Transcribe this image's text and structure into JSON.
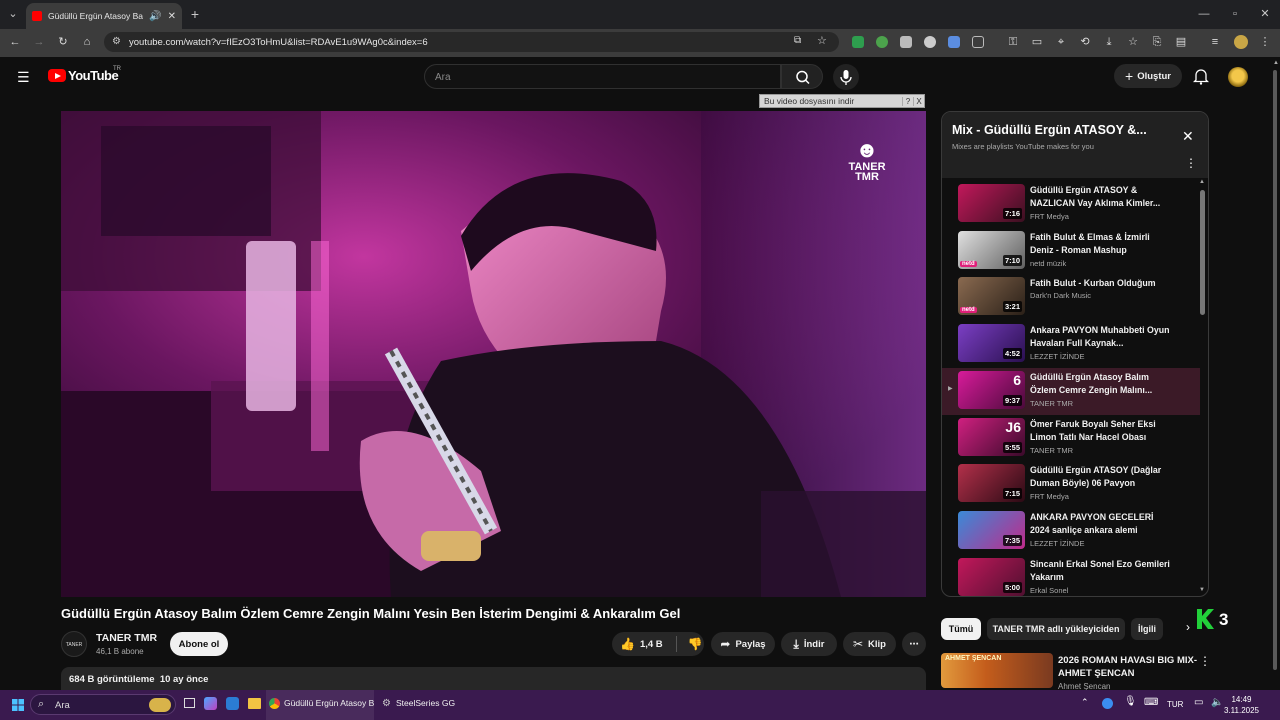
{
  "browser": {
    "tab_title": "Güdüllü Ergün Atasoy Balım",
    "url": "youtube.com/watch?v=fIEzO3ToHmU&list=RDAvE1u9WAg0c&index=6"
  },
  "header": {
    "logo_text": "YouTube",
    "logo_region": "TR",
    "search_placeholder": "Ara",
    "create_label": "Oluştur"
  },
  "download_bar": {
    "label": "Bu video dosyasını indir",
    "help": "?",
    "close": "X"
  },
  "video": {
    "watermark": "TANER\nTMR",
    "title": "Güdüllü Ergün Atasoy Balım Özlem Cemre Zengin Malını Yesin Ben İsterim Dengimi & Ankaralım Gel"
  },
  "channel": {
    "name": "TANER TMR",
    "subscribers": "46,1 B abone",
    "avatar_text": "TANER TMR",
    "subscribe_label": "Abone ol"
  },
  "actions": {
    "likes": "1,4 B",
    "share": "Paylaş",
    "download": "İndir",
    "clip": "Klip",
    "more": "⋯"
  },
  "description": {
    "views": "684 B görüntüleme",
    "age": "10 ay önce"
  },
  "playlist": {
    "title": "Mix - Güdüllü Ergün ATASOY &...",
    "subtitle": "Mixes are playlists YouTube makes for you",
    "items": [
      {
        "title": "Güdüllü Ergün ATASOY & NAZLICAN Vay Aklıma Kimler...",
        "channel": "FRT Medya",
        "duration": "7:16",
        "c1": "#c2185b",
        "c2": "#3a1020"
      },
      {
        "title": "Fatih Bulut & Elmas & İzmirli Deniz - Roman Mashup",
        "channel": "netd müzik",
        "duration": "7:10",
        "c1": "#e0e0e0",
        "c2": "#606060",
        "badge": "netd"
      },
      {
        "title": "Fatih Bulut - Kurban Olduğum",
        "channel": "Dark'n Dark Music",
        "duration": "3:21",
        "c1": "#8a6a50",
        "c2": "#2a2018",
        "badge": "netd"
      },
      {
        "title": "Ankara PAVYON Muhabbeti Oyun Havaları Full Kaynak...",
        "channel": "LEZZET İZİNDE",
        "duration": "4:52",
        "c1": "#7b3fc4",
        "c2": "#2a1050"
      },
      {
        "title": "Güdüllü Ergün Atasoy Balım Özlem Cemre Zengin Malını...",
        "channel": "TANER TMR",
        "duration": "9:37",
        "c1": "#d81b9a",
        "c2": "#4a0a3a",
        "index": "6",
        "current": true
      },
      {
        "title": "Ömer Faruk Boyalı Seher Eksi Limon Tatlı Nar Hacel Obası",
        "channel": "TANER TMR",
        "duration": "5:55",
        "c1": "#d02080",
        "c2": "#3a0a2a",
        "index": "J6"
      },
      {
        "title": "Güdüllü Ergün ATASOY (Dağlar Duman Böyle) 06 Pavyon",
        "channel": "FRT Medya",
        "duration": "7:15",
        "c1": "#b3304a",
        "c2": "#2a0a14"
      },
      {
        "title": "ANKARA PAVYON GECELERİ 2024 sanliçe ankara alemi",
        "channel": "LEZZET İZİNDE",
        "duration": "7:35",
        "c1": "#3a8ad8",
        "c2": "#c02a8a"
      },
      {
        "title": "Sincanlı Erkal Sonel Ezo Gemileri Yakarım",
        "channel": "Erkal Sonel",
        "duration": "5:00",
        "c1": "#c2185b",
        "c2": "#501030"
      }
    ]
  },
  "chips": [
    "Tümü",
    "TANER TMR adlı yükleyiciden",
    "İlgili"
  ],
  "overlay_badge": "3",
  "recommendation": {
    "title": "2026 ROMAN HAVASI BIG MIX-AHMET ŞENCAN",
    "channel": "Ahmet Şencan",
    "thumb_text": "AHMET ŞENCAN"
  },
  "taskbar": {
    "search_placeholder": "Ara",
    "apps": [
      "Güdüllü Ergün Atasoy B",
      "SteelSeries GG"
    ],
    "lang": "TUR",
    "time": "14:49",
    "date": "3.11.2025"
  }
}
